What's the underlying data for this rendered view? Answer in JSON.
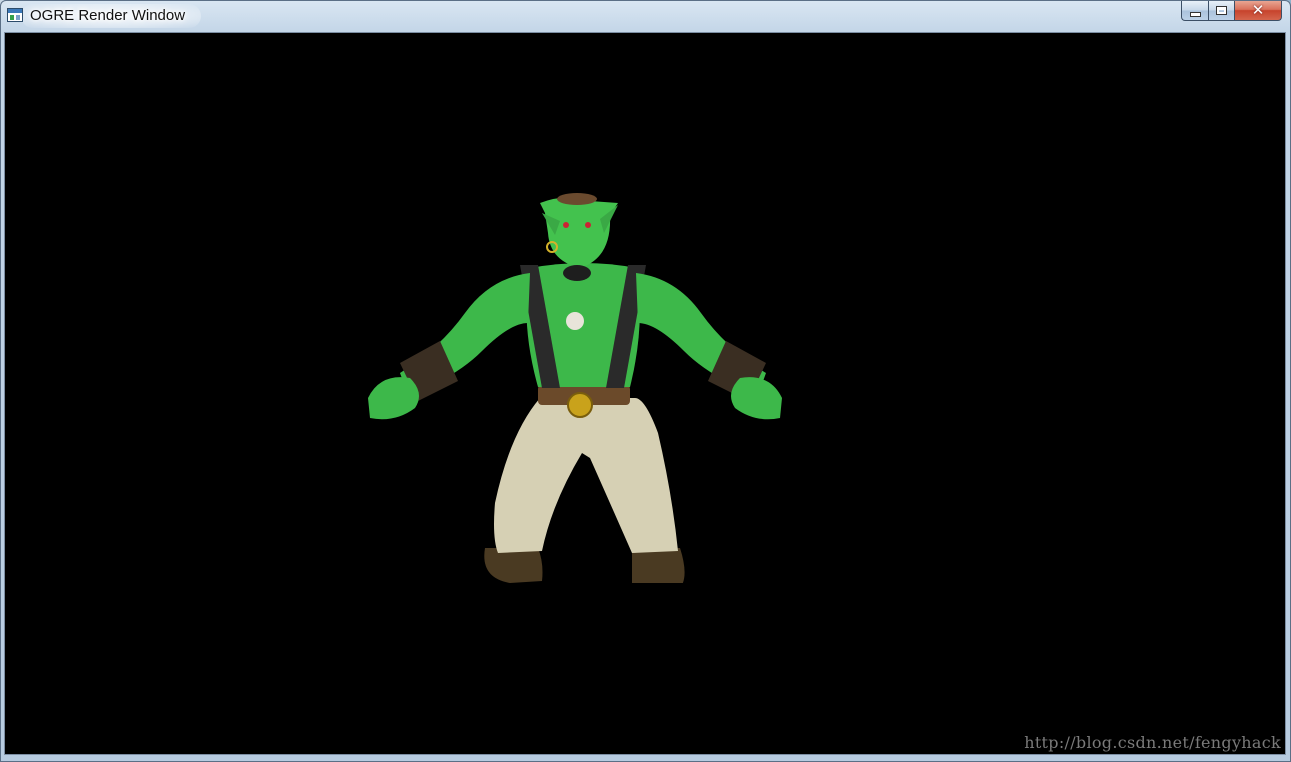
{
  "window": {
    "title": "OGRE Render Window",
    "icon": "ogre-app-icon",
    "caption_buttons": [
      {
        "name": "minimize",
        "icon": "minimize-icon"
      },
      {
        "name": "maximize",
        "icon": "maximize-icon"
      },
      {
        "name": "close",
        "icon": "close-icon",
        "glyph": "✕"
      }
    ]
  },
  "viewport": {
    "background": "#000000",
    "model": "green orc character",
    "watermark": "http://blog.csdn.net/fengyhack"
  },
  "colors": {
    "titlebar": "#c4d6e8",
    "close_button": "#c7432c",
    "orc_skin": "#3db84a"
  }
}
